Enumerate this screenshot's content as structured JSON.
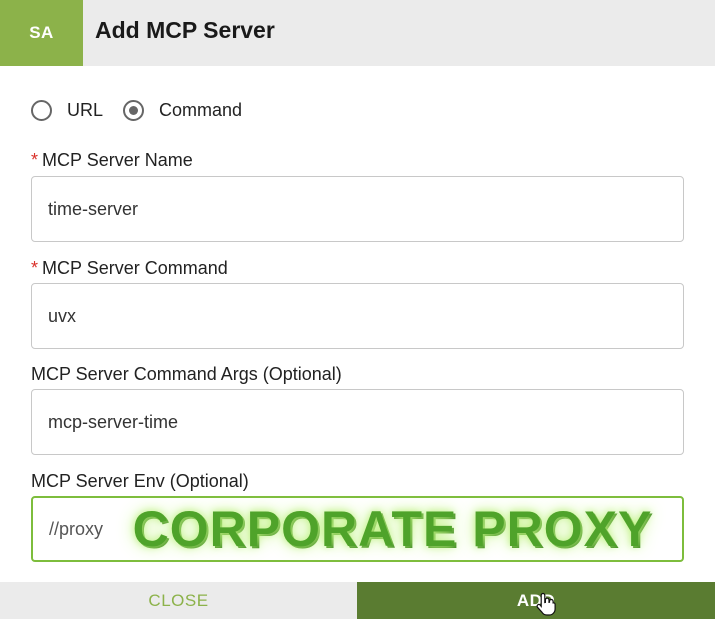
{
  "header": {
    "avatar": "SA",
    "title": "Add MCP Server"
  },
  "mode": {
    "options": [
      {
        "label": "URL",
        "selected": false
      },
      {
        "label": "Command",
        "selected": true
      }
    ]
  },
  "form": {
    "name": {
      "required_mark": "*",
      "label": "MCP Server Name",
      "value": "time-server"
    },
    "command": {
      "required_mark": "*",
      "label": "MCP Server Command",
      "value": "uvx"
    },
    "args": {
      "label": "MCP Server Command Args (Optional)",
      "value": "mcp-server-time"
    },
    "env": {
      "label": "MCP Server Env (Optional)",
      "value": "//proxy"
    }
  },
  "overlay": {
    "watermark": "CORPORATE PROXY"
  },
  "footer": {
    "close_label": "CLOSE",
    "add_label": "ADD"
  },
  "colors": {
    "accent": "#8cb24a",
    "primary_button": "#5a7c31",
    "required": "#d9302a",
    "watermark": "#4fa32a"
  },
  "icons": {
    "cursor": "hand-pointer-icon"
  }
}
